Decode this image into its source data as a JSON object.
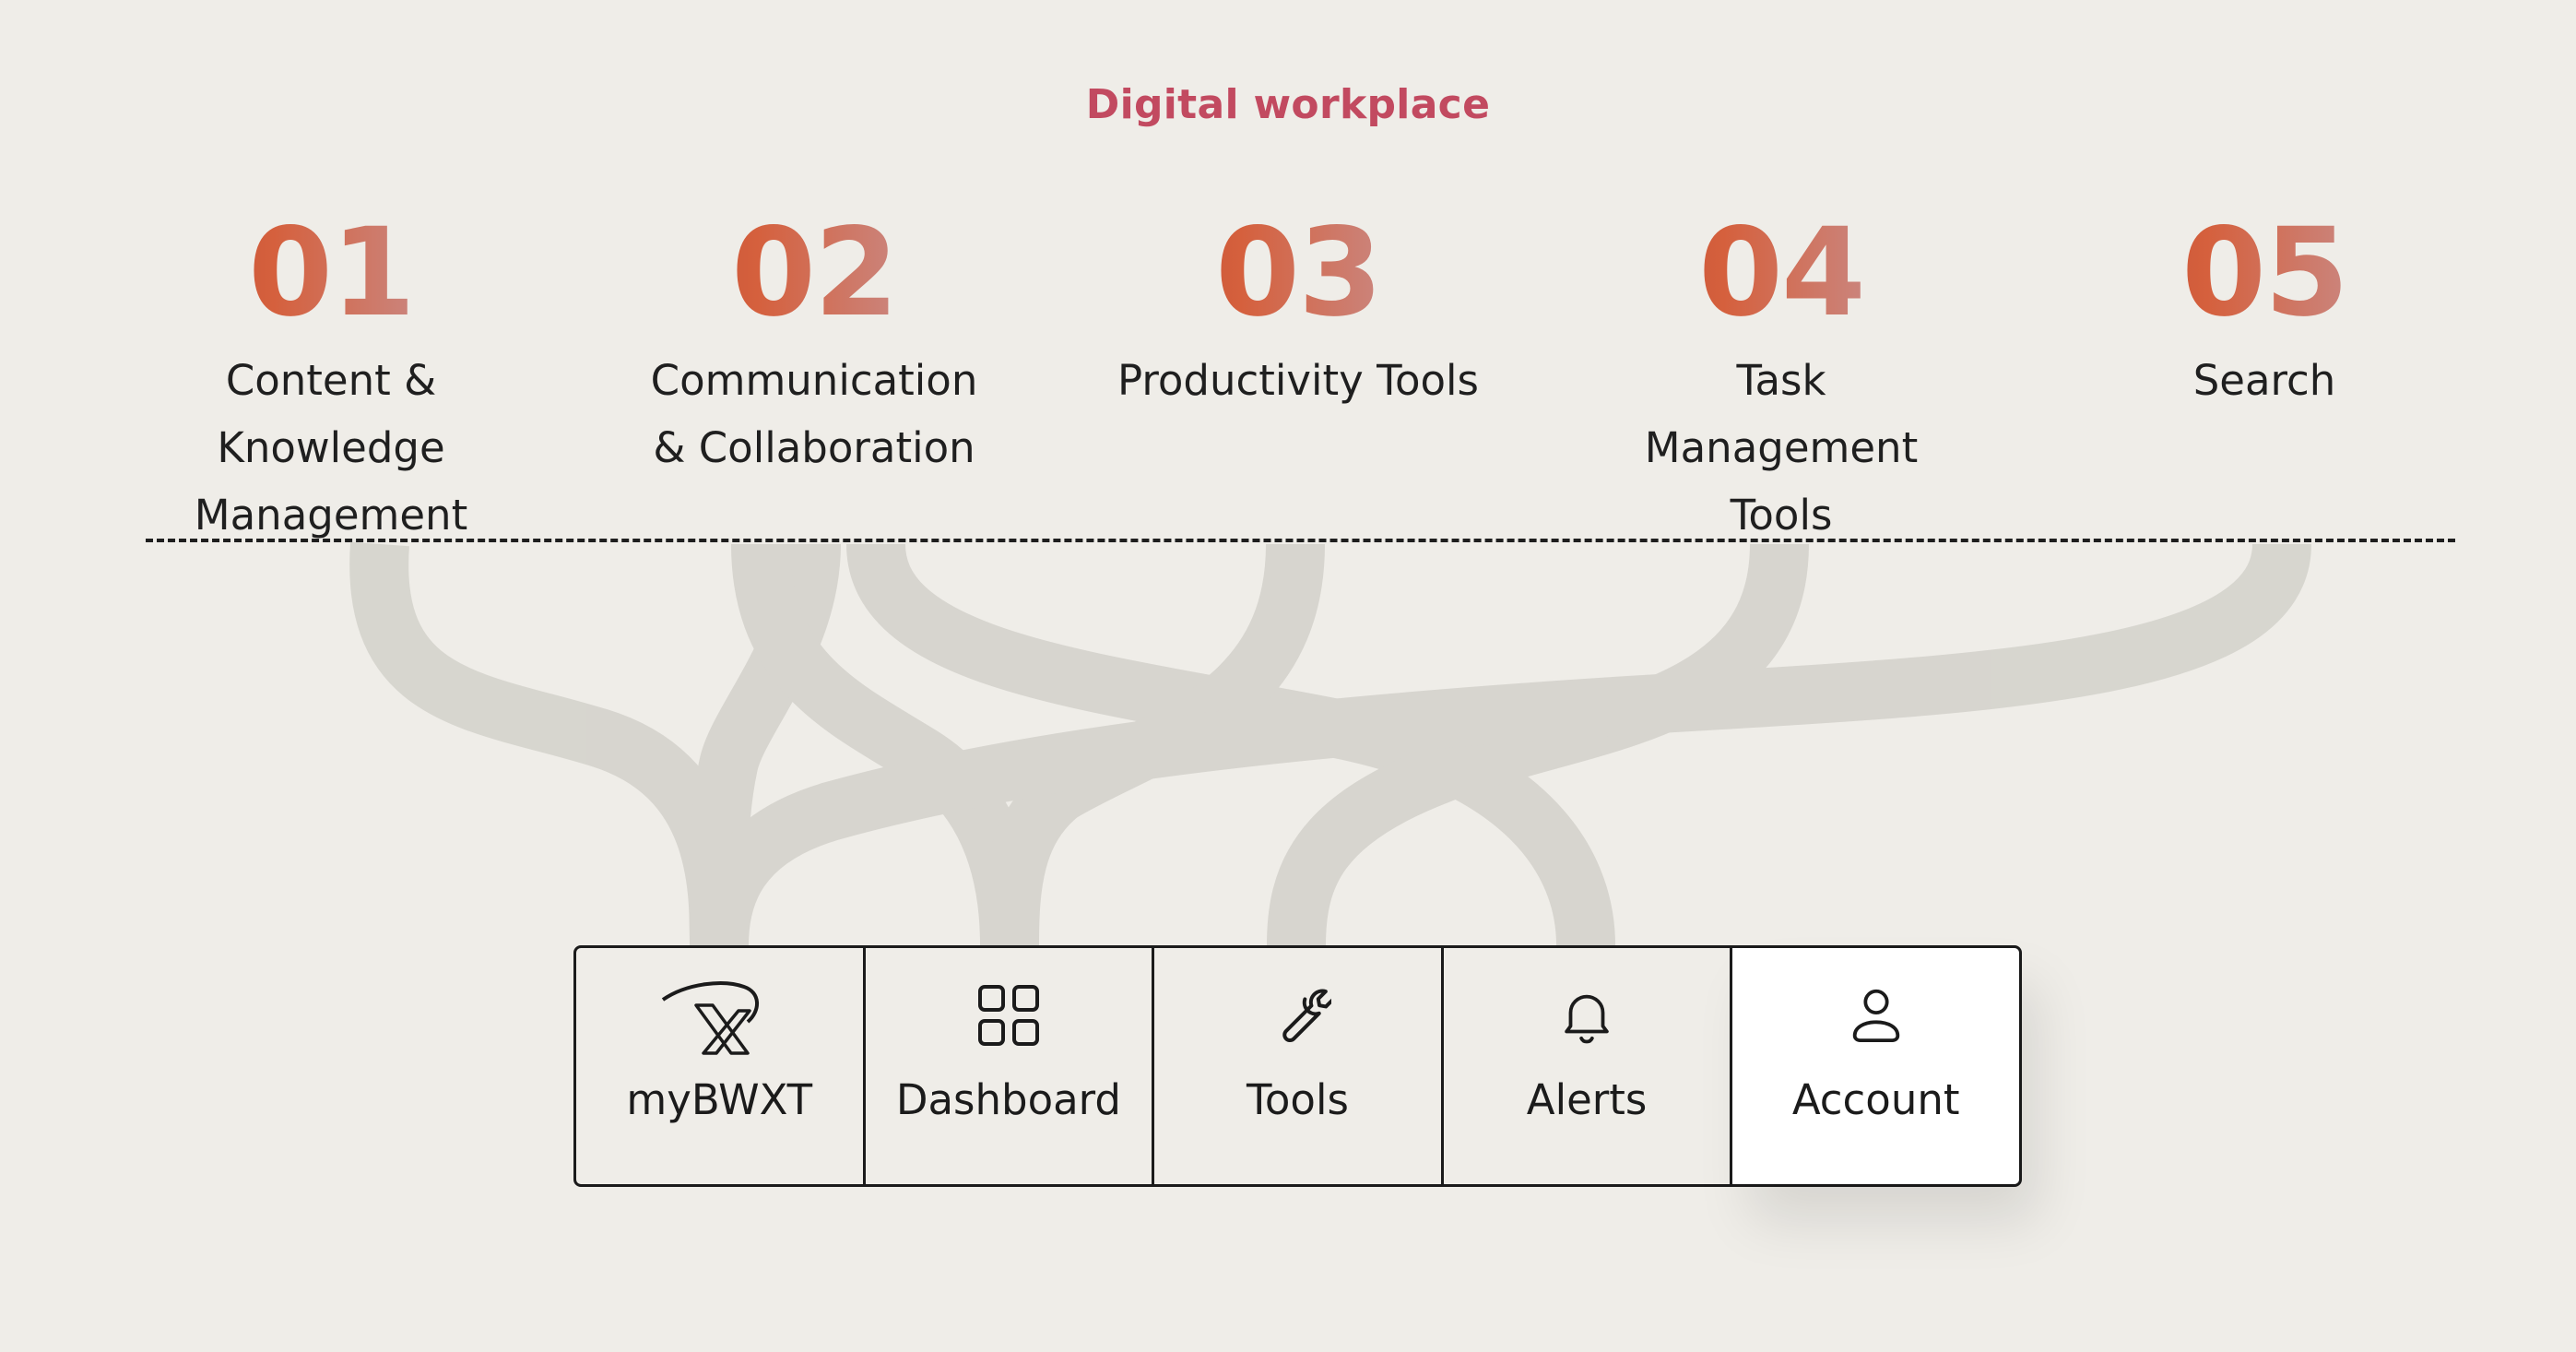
{
  "header": {
    "title": "Digital workplace"
  },
  "categories": [
    {
      "number": "01",
      "label": "Content & Knowledge Management"
    },
    {
      "number": "02",
      "label": "Communication & Collaboration"
    },
    {
      "number": "03",
      "label": "Productivity Tools"
    },
    {
      "number": "04",
      "label": "Task Management Tools"
    },
    {
      "number": "05",
      "label": "Search"
    }
  ],
  "dock": {
    "tabs": [
      {
        "label": "myBWXT",
        "icon": "bwxt-logo-icon"
      },
      {
        "label": "Dashboard",
        "icon": "grid-icon"
      },
      {
        "label": "Tools",
        "icon": "wrench-icon"
      },
      {
        "label": "Alerts",
        "icon": "bell-icon"
      },
      {
        "label": "Account",
        "icon": "user-icon",
        "active": true
      }
    ]
  },
  "colors": {
    "background": "#efede8",
    "title_accent": "#c24a60",
    "number_gradient": [
      "#b24331",
      "#d5603d",
      "#c98a86",
      "#e6c3ba"
    ],
    "flow_stroke": "#cfcdc7"
  },
  "flows": [
    {
      "from": "Content & Knowledge Management",
      "to": "myBWXT"
    },
    {
      "from": "Communication & Collaboration",
      "to": "myBWXT"
    },
    {
      "from": "Communication & Collaboration",
      "to": "Dashboard"
    },
    {
      "from": "Communication & Collaboration",
      "to": "Alerts"
    },
    {
      "from": "Productivity Tools",
      "to": "Dashboard"
    },
    {
      "from": "Task Management Tools",
      "to": "Tools"
    },
    {
      "from": "Search",
      "to": "myBWXT"
    }
  ]
}
